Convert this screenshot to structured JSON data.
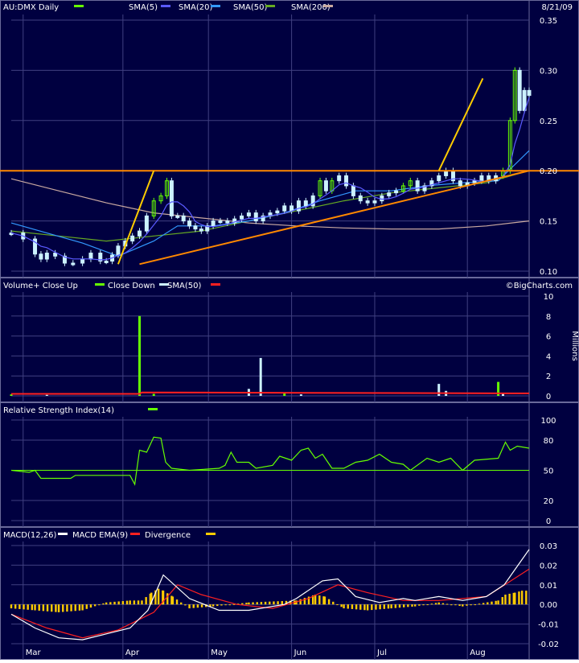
{
  "colors": {
    "background": "#000040",
    "frame": "#6a6a9a",
    "grid": "#404080",
    "up": "#66ff00",
    "down": "#ccf2ff",
    "sma5": "#5a5aff",
    "sma20": "#3399ff",
    "sma50": "#66aa22",
    "sma200": "#c8a8a0",
    "trendline": "#ff8800",
    "steepline": "#ffcc00",
    "volume_sma": "#ff2020",
    "rsi": "#66ff00",
    "macd": "#ffffff",
    "macd_ema": "#ff2020",
    "divergence": "#ffcc00"
  },
  "chart_data": [
    {
      "type": "candlestick",
      "title": "AU:DMX Daily",
      "date": "8/21/09",
      "legend": [
        "SMA(5)",
        "SMA(20)",
        "SMA(50)",
        "SMA(200)"
      ],
      "ylim": [
        0.1,
        0.35
      ],
      "yticks": [
        "0.35",
        "0.30",
        "0.25",
        "0.20",
        "0.15",
        "0.10"
      ],
      "xticks": [
        "Mar",
        "Apr",
        "May",
        "Jun",
        "Jul",
        "Aug"
      ],
      "close": [
        {
          "x": 0,
          "y": 0.138
        },
        {
          "x": 10,
          "y": 0.132
        },
        {
          "x": 20,
          "y": 0.117
        },
        {
          "x": 25,
          "y": 0.112
        },
        {
          "x": 30,
          "y": 0.118
        },
        {
          "x": 37,
          "y": 0.115
        },
        {
          "x": 45,
          "y": 0.108
        },
        {
          "x": 52,
          "y": 0.108
        },
        {
          "x": 60,
          "y": 0.112
        },
        {
          "x": 67,
          "y": 0.118
        },
        {
          "x": 75,
          "y": 0.11
        },
        {
          "x": 80,
          "y": 0.11
        },
        {
          "x": 85,
          "y": 0.116
        },
        {
          "x": 90,
          "y": 0.125
        },
        {
          "x": 96,
          "y": 0.13
        },
        {
          "x": 102,
          "y": 0.135
        },
        {
          "x": 108,
          "y": 0.14
        },
        {
          "x": 114,
          "y": 0.155
        },
        {
          "x": 120,
          "y": 0.17
        },
        {
          "x": 126,
          "y": 0.175
        },
        {
          "x": 131,
          "y": 0.19
        },
        {
          "x": 135,
          "y": 0.155
        },
        {
          "x": 140,
          "y": 0.155
        },
        {
          "x": 145,
          "y": 0.15
        },
        {
          "x": 150,
          "y": 0.145
        },
        {
          "x": 155,
          "y": 0.142
        },
        {
          "x": 160,
          "y": 0.14
        },
        {
          "x": 165,
          "y": 0.145
        },
        {
          "x": 170,
          "y": 0.15
        },
        {
          "x": 176,
          "y": 0.15
        },
        {
          "x": 182,
          "y": 0.148
        },
        {
          "x": 188,
          "y": 0.152
        },
        {
          "x": 194,
          "y": 0.155
        },
        {
          "x": 200,
          "y": 0.158
        },
        {
          "x": 206,
          "y": 0.15
        },
        {
          "x": 212,
          "y": 0.155
        },
        {
          "x": 218,
          "y": 0.158
        },
        {
          "x": 224,
          "y": 0.16
        },
        {
          "x": 230,
          "y": 0.165
        },
        {
          "x": 236,
          "y": 0.16
        },
        {
          "x": 242,
          "y": 0.17
        },
        {
          "x": 248,
          "y": 0.165
        },
        {
          "x": 254,
          "y": 0.175
        },
        {
          "x": 260,
          "y": 0.19
        },
        {
          "x": 265,
          "y": 0.18
        },
        {
          "x": 270,
          "y": 0.19
        },
        {
          "x": 276,
          "y": 0.195
        },
        {
          "x": 282,
          "y": 0.185
        },
        {
          "x": 288,
          "y": 0.175
        },
        {
          "x": 294,
          "y": 0.17
        },
        {
          "x": 300,
          "y": 0.168
        },
        {
          "x": 306,
          "y": 0.17
        },
        {
          "x": 312,
          "y": 0.175
        },
        {
          "x": 318,
          "y": 0.178
        },
        {
          "x": 324,
          "y": 0.18
        },
        {
          "x": 330,
          "y": 0.185
        },
        {
          "x": 336,
          "y": 0.19
        },
        {
          "x": 342,
          "y": 0.18
        },
        {
          "x": 348,
          "y": 0.185
        },
        {
          "x": 354,
          "y": 0.19
        },
        {
          "x": 360,
          "y": 0.195
        },
        {
          "x": 366,
          "y": 0.2
        },
        {
          "x": 372,
          "y": 0.19
        },
        {
          "x": 378,
          "y": 0.185
        },
        {
          "x": 384,
          "y": 0.188
        },
        {
          "x": 390,
          "y": 0.19
        },
        {
          "x": 396,
          "y": 0.195
        },
        {
          "x": 402,
          "y": 0.19
        },
        {
          "x": 408,
          "y": 0.195
        },
        {
          "x": 414,
          "y": 0.2
        },
        {
          "x": 420,
          "y": 0.25
        },
        {
          "x": 424,
          "y": 0.3
        },
        {
          "x": 428,
          "y": 0.26
        },
        {
          "x": 432,
          "y": 0.28
        },
        {
          "x": 436,
          "y": 0.275
        }
      ],
      "candles_up_x": [
        120,
        126,
        131,
        260,
        270,
        330,
        336,
        414,
        420,
        424
      ],
      "sma20": [
        {
          "x": 0,
          "y": 0.148
        },
        {
          "x": 30,
          "y": 0.138
        },
        {
          "x": 60,
          "y": 0.128
        },
        {
          "x": 90,
          "y": 0.115
        },
        {
          "x": 120,
          "y": 0.13
        },
        {
          "x": 140,
          "y": 0.145
        },
        {
          "x": 170,
          "y": 0.145
        },
        {
          "x": 200,
          "y": 0.15
        },
        {
          "x": 230,
          "y": 0.158
        },
        {
          "x": 260,
          "y": 0.17
        },
        {
          "x": 290,
          "y": 0.18
        },
        {
          "x": 320,
          "y": 0.18
        },
        {
          "x": 350,
          "y": 0.185
        },
        {
          "x": 380,
          "y": 0.188
        },
        {
          "x": 410,
          "y": 0.19
        },
        {
          "x": 436,
          "y": 0.22
        }
      ],
      "sma50": [
        {
          "x": 0,
          "y": 0.14
        },
        {
          "x": 40,
          "y": 0.135
        },
        {
          "x": 80,
          "y": 0.13
        },
        {
          "x": 120,
          "y": 0.135
        },
        {
          "x": 160,
          "y": 0.14
        },
        {
          "x": 200,
          "y": 0.15
        },
        {
          "x": 240,
          "y": 0.16
        },
        {
          "x": 280,
          "y": 0.17
        },
        {
          "x": 320,
          "y": 0.178
        },
        {
          "x": 360,
          "y": 0.183
        },
        {
          "x": 400,
          "y": 0.188
        },
        {
          "x": 436,
          "y": 0.2
        }
      ],
      "sma200": [
        {
          "x": 0,
          "y": 0.192
        },
        {
          "x": 40,
          "y": 0.18
        },
        {
          "x": 80,
          "y": 0.168
        },
        {
          "x": 120,
          "y": 0.158
        },
        {
          "x": 160,
          "y": 0.153
        },
        {
          "x": 200,
          "y": 0.148
        },
        {
          "x": 240,
          "y": 0.145
        },
        {
          "x": 280,
          "y": 0.143
        },
        {
          "x": 320,
          "y": 0.142
        },
        {
          "x": 360,
          "y": 0.142
        },
        {
          "x": 400,
          "y": 0.145
        },
        {
          "x": 436,
          "y": 0.15
        }
      ],
      "trendline": [
        {
          "x": 108,
          "y": 0.107
        },
        {
          "x": 436,
          "y": 0.2
        }
      ],
      "resistance": 0.2,
      "steep_lines": [
        [
          {
            "x": 90,
            "y": 0.107
          },
          {
            "x": 120,
            "y": 0.2
          }
        ],
        [
          {
            "x": 360,
            "y": 0.2
          },
          {
            "x": 397,
            "y": 0.292
          }
        ]
      ]
    },
    {
      "type": "bar",
      "title": "Volume+ Close Up",
      "legend": [
        "Close Down",
        "SMA(50)"
      ],
      "ylabel": "Millions",
      "ylim": [
        0,
        10
      ],
      "yticks": [
        "10",
        "8",
        "6",
        "4",
        "2",
        "0"
      ],
      "bars": [
        {
          "x": 0,
          "v": 0.15,
          "up": true
        },
        {
          "x": 30,
          "v": 0.1,
          "up": false
        },
        {
          "x": 108,
          "v": 8.0,
          "up": true
        },
        {
          "x": 120,
          "v": 0.2,
          "up": true
        },
        {
          "x": 200,
          "v": 0.7,
          "up": false
        },
        {
          "x": 210,
          "v": 3.8,
          "up": false
        },
        {
          "x": 230,
          "v": 0.3,
          "up": true
        },
        {
          "x": 244,
          "v": 0.15,
          "up": false
        },
        {
          "x": 360,
          "v": 1.2,
          "up": false
        },
        {
          "x": 366,
          "v": 0.5,
          "up": false
        },
        {
          "x": 410,
          "v": 1.4,
          "up": true
        },
        {
          "x": 414,
          "v": 0.3,
          "up": false
        }
      ],
      "sma50": [
        {
          "x": 0,
          "v": 0.2
        },
        {
          "x": 108,
          "v": 0.2
        },
        {
          "x": 110,
          "v": 0.35
        },
        {
          "x": 436,
          "v": 0.25
        }
      ]
    },
    {
      "type": "line",
      "title": "Relative Strength Index(14)",
      "ylim": [
        0,
        100
      ],
      "yticks": [
        "100",
        "80",
        "50",
        "20",
        "0"
      ],
      "reference": 50,
      "values": [
        {
          "x": 0,
          "y": 50
        },
        {
          "x": 15,
          "y": 48
        },
        {
          "x": 20,
          "y": 50
        },
        {
          "x": 25,
          "y": 42
        },
        {
          "x": 50,
          "y": 42
        },
        {
          "x": 54,
          "y": 45
        },
        {
          "x": 100,
          "y": 45
        },
        {
          "x": 104,
          "y": 36
        },
        {
          "x": 108,
          "y": 70
        },
        {
          "x": 114,
          "y": 68
        },
        {
          "x": 120,
          "y": 83
        },
        {
          "x": 126,
          "y": 82
        },
        {
          "x": 130,
          "y": 58
        },
        {
          "x": 135,
          "y": 52
        },
        {
          "x": 150,
          "y": 50
        },
        {
          "x": 175,
          "y": 52
        },
        {
          "x": 180,
          "y": 55
        },
        {
          "x": 185,
          "y": 68
        },
        {
          "x": 190,
          "y": 58
        },
        {
          "x": 200,
          "y": 58
        },
        {
          "x": 206,
          "y": 52
        },
        {
          "x": 220,
          "y": 55
        },
        {
          "x": 226,
          "y": 64
        },
        {
          "x": 236,
          "y": 60
        },
        {
          "x": 244,
          "y": 70
        },
        {
          "x": 250,
          "y": 72
        },
        {
          "x": 256,
          "y": 62
        },
        {
          "x": 262,
          "y": 66
        },
        {
          "x": 270,
          "y": 52
        },
        {
          "x": 280,
          "y": 52
        },
        {
          "x": 290,
          "y": 58
        },
        {
          "x": 300,
          "y": 60
        },
        {
          "x": 310,
          "y": 66
        },
        {
          "x": 320,
          "y": 58
        },
        {
          "x": 330,
          "y": 56
        },
        {
          "x": 336,
          "y": 50
        },
        {
          "x": 350,
          "y": 62
        },
        {
          "x": 360,
          "y": 58
        },
        {
          "x": 370,
          "y": 62
        },
        {
          "x": 380,
          "y": 50
        },
        {
          "x": 390,
          "y": 60
        },
        {
          "x": 410,
          "y": 62
        },
        {
          "x": 416,
          "y": 78
        },
        {
          "x": 420,
          "y": 70
        },
        {
          "x": 426,
          "y": 74
        },
        {
          "x": 436,
          "y": 72
        }
      ]
    },
    {
      "type": "line",
      "title": "MACD(12,26)",
      "legend": [
        "MACD EMA(9)",
        "Divergence"
      ],
      "ylim": [
        -0.02,
        0.03
      ],
      "yticks": [
        "0.03",
        "0.02",
        "0.01",
        "0.00",
        "-0.01",
        "-0.02"
      ],
      "xticks": [
        "Mar",
        "Apr",
        "May",
        "Jun",
        "Jul",
        "Aug"
      ],
      "macd": [
        {
          "x": 0,
          "y": -0.005
        },
        {
          "x": 20,
          "y": -0.012
        },
        {
          "x": 40,
          "y": -0.017
        },
        {
          "x": 60,
          "y": -0.018
        },
        {
          "x": 80,
          "y": -0.015
        },
        {
          "x": 100,
          "y": -0.012
        },
        {
          "x": 115,
          "y": -0.003
        },
        {
          "x": 128,
          "y": 0.015
        },
        {
          "x": 150,
          "y": 0.003
        },
        {
          "x": 175,
          "y": -0.003
        },
        {
          "x": 200,
          "y": -0.003
        },
        {
          "x": 230,
          "y": 0.0
        },
        {
          "x": 240,
          "y": 0.003
        },
        {
          "x": 262,
          "y": 0.012
        },
        {
          "x": 275,
          "y": 0.013
        },
        {
          "x": 290,
          "y": 0.004
        },
        {
          "x": 310,
          "y": 0.001
        },
        {
          "x": 330,
          "y": 0.003
        },
        {
          "x": 340,
          "y": 0.002
        },
        {
          "x": 360,
          "y": 0.004
        },
        {
          "x": 380,
          "y": 0.002
        },
        {
          "x": 400,
          "y": 0.004
        },
        {
          "x": 415,
          "y": 0.01
        },
        {
          "x": 436,
          "y": 0.028
        }
      ],
      "ema": [
        {
          "x": 0,
          "y": -0.005
        },
        {
          "x": 30,
          "y": -0.012
        },
        {
          "x": 60,
          "y": -0.017
        },
        {
          "x": 90,
          "y": -0.013
        },
        {
          "x": 120,
          "y": -0.004
        },
        {
          "x": 140,
          "y": 0.01
        },
        {
          "x": 160,
          "y": 0.005
        },
        {
          "x": 190,
          "y": 0.0
        },
        {
          "x": 220,
          "y": -0.002
        },
        {
          "x": 250,
          "y": 0.003
        },
        {
          "x": 275,
          "y": 0.01
        },
        {
          "x": 300,
          "y": 0.006
        },
        {
          "x": 330,
          "y": 0.002
        },
        {
          "x": 360,
          "y": 0.002
        },
        {
          "x": 400,
          "y": 0.004
        },
        {
          "x": 436,
          "y": 0.018
        }
      ],
      "divergence": [
        {
          "x": 0,
          "y": -0.002
        },
        {
          "x": 20,
          "y": -0.003
        },
        {
          "x": 40,
          "y": -0.004
        },
        {
          "x": 60,
          "y": -0.003
        },
        {
          "x": 80,
          "y": 0.001
        },
        {
          "x": 100,
          "y": 0.002
        },
        {
          "x": 110,
          "y": 0.002
        },
        {
          "x": 118,
          "y": 0.006
        },
        {
          "x": 124,
          "y": 0.008
        },
        {
          "x": 128,
          "y": 0.007
        },
        {
          "x": 136,
          "y": 0.004
        },
        {
          "x": 150,
          "y": -0.002
        },
        {
          "x": 170,
          "y": -0.001
        },
        {
          "x": 200,
          "y": 0.001
        },
        {
          "x": 240,
          "y": 0.002
        },
        {
          "x": 256,
          "y": 0.005
        },
        {
          "x": 264,
          "y": 0.004
        },
        {
          "x": 280,
          "y": -0.002
        },
        {
          "x": 300,
          "y": -0.003
        },
        {
          "x": 320,
          "y": -0.002
        },
        {
          "x": 340,
          "y": -0.001
        },
        {
          "x": 360,
          "y": 0.001
        },
        {
          "x": 380,
          "y": -0.001
        },
        {
          "x": 410,
          "y": 0.002
        },
        {
          "x": 416,
          "y": 0.005
        },
        {
          "x": 424,
          "y": 0.006
        },
        {
          "x": 430,
          "y": 0.007
        },
        {
          "x": 436,
          "y": 0.007
        }
      ]
    }
  ],
  "watermark": "©BigCharts.com"
}
